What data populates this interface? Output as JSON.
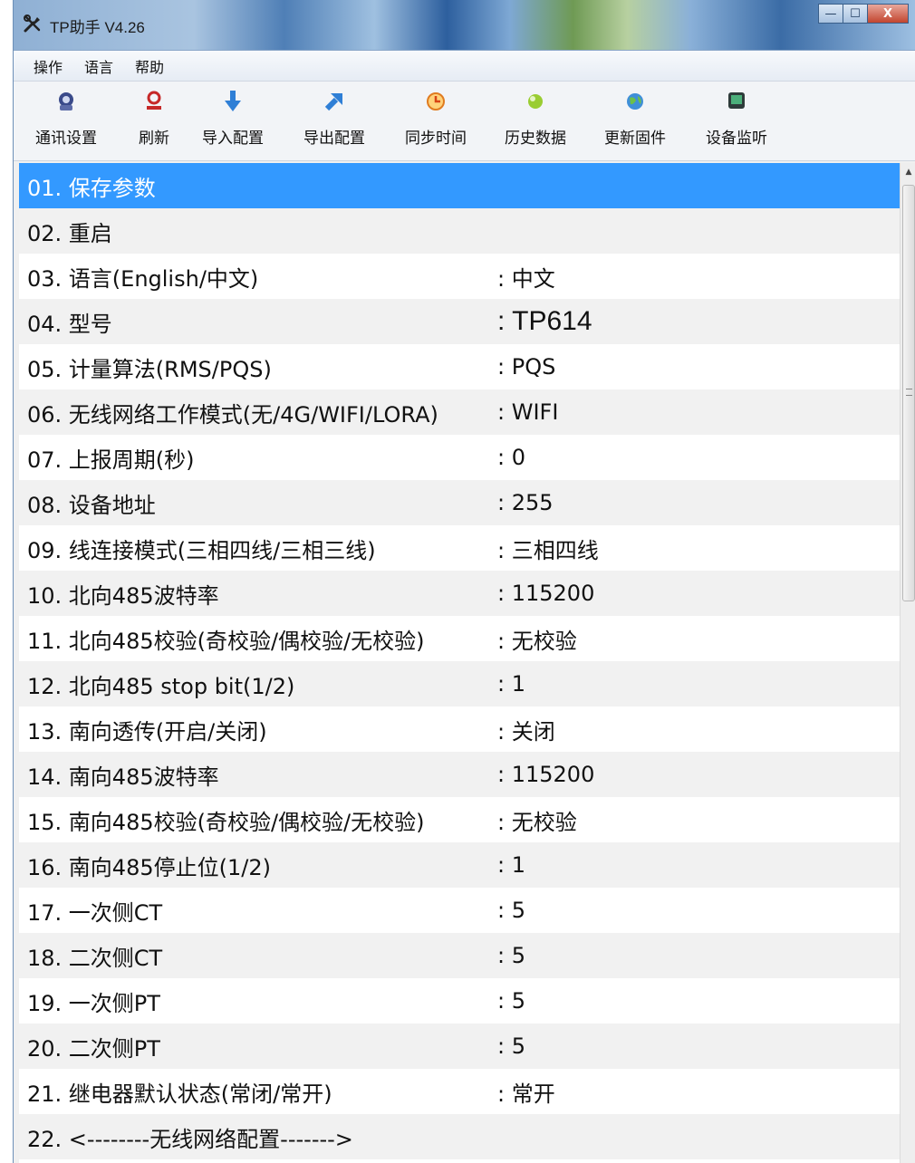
{
  "window": {
    "title": "TP助手 V4.26",
    "icon": "tools-icon",
    "buttons": {
      "minimize": "—",
      "maximize": "☐",
      "close": "X"
    }
  },
  "menubar": {
    "items": [
      "操作",
      "语言",
      "帮助"
    ]
  },
  "toolbar": {
    "items": [
      {
        "label": "通讯设置",
        "icon": "connection-settings-icon"
      },
      {
        "label": "刷新",
        "icon": "refresh-icon"
      },
      {
        "label": "导入配置",
        "icon": "import-arrow-icon"
      },
      {
        "label": "导出配置",
        "icon": "export-arrow-icon"
      },
      {
        "label": "同步时间",
        "icon": "clock-sync-icon"
      },
      {
        "label": "历史数据",
        "icon": "history-data-icon"
      },
      {
        "label": "更新固件",
        "icon": "globe-update-icon"
      },
      {
        "label": "设备监听",
        "icon": "monitor-icon"
      }
    ]
  },
  "params": {
    "selected_index": 0,
    "selected_color": "#3399ff",
    "rows": [
      {
        "label": "01. 保存参数",
        "value": ""
      },
      {
        "label": "02. 重启",
        "value": ""
      },
      {
        "label": "03. 语言(English/中文)",
        "value": ": 中文"
      },
      {
        "label": "04. 型号",
        "value": ": TP614"
      },
      {
        "label": "05. 计量算法(RMS/PQS)",
        "value": ": PQS"
      },
      {
        "label": "06. 无线网络工作模式(无/4G/WIFI/LORA)",
        "value": ": WIFI"
      },
      {
        "label": "07. 上报周期(秒)",
        "value": ": 0"
      },
      {
        "label": "08. 设备地址",
        "value": ": 255"
      },
      {
        "label": "09. 线连接模式(三相四线/三相三线)",
        "value": ": 三相四线"
      },
      {
        "label": "10. 北向485波特率",
        "value": ": 115200"
      },
      {
        "label": "11. 北向485校验(奇校验/偶校验/无校验)",
        "value": ": 无校验"
      },
      {
        "label": "12. 北向485 stop bit(1/2)",
        "value": ": 1"
      },
      {
        "label": "13. 南向透传(开启/关闭)",
        "value": ": 关闭"
      },
      {
        "label": "14. 南向485波特率",
        "value": ": 115200"
      },
      {
        "label": "15. 南向485校验(奇校验/偶校验/无校验)",
        "value": ": 无校验"
      },
      {
        "label": "16. 南向485停止位(1/2)",
        "value": ": 1"
      },
      {
        "label": "17. 一次侧CT",
        "value": ": 5"
      },
      {
        "label": "18. 二次侧CT",
        "value": ": 5"
      },
      {
        "label": "19. 一次侧PT",
        "value": ": 5"
      },
      {
        "label": "20. 二次侧PT",
        "value": ": 5"
      },
      {
        "label": "21. 继电器默认状态(常闭/常开)",
        "value": ": 常开"
      },
      {
        "label": "22. <--------无线网络配置------->",
        "value": ""
      }
    ]
  },
  "scrollbar": {
    "position": 0.0
  }
}
